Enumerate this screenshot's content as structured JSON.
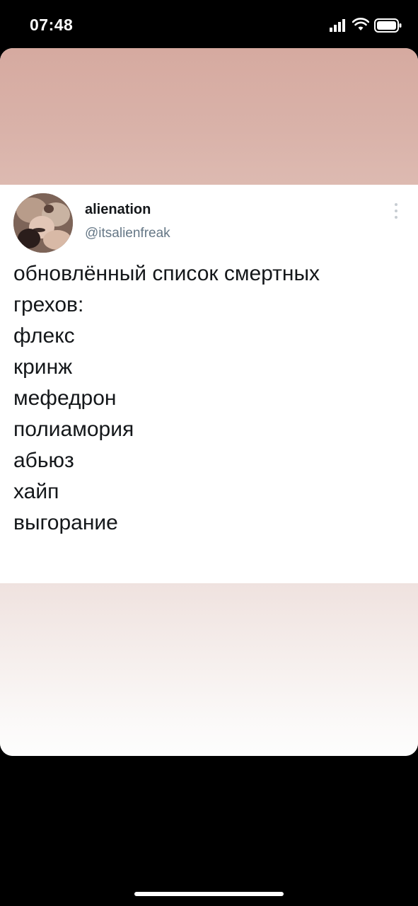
{
  "status_bar": {
    "time": "07:48",
    "icons": [
      "signal-icon",
      "wifi-icon",
      "battery-icon"
    ]
  },
  "tweet": {
    "author": {
      "name": "alienation",
      "handle": "@itsalienfreak"
    },
    "text_lines": [
      "обновлённый список смертных",
      "грехов:",
      "флекс",
      "кринж",
      "мефедрон",
      "полиамория",
      "абьюз",
      "хайп",
      "выгорание"
    ],
    "menu_icon": "more-vertical-icon"
  },
  "colors": {
    "top_band": "#d6aaa0",
    "bottom_band": "#efe2df",
    "handle": "#657786",
    "text": "#14171a",
    "screen_background": "#000000"
  }
}
